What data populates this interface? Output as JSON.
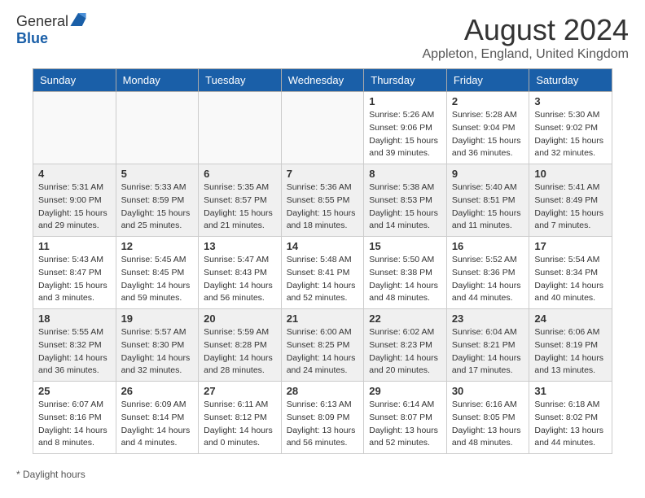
{
  "header": {
    "logo_general": "General",
    "logo_blue": "Blue",
    "month_title": "August 2024",
    "location": "Appleton, England, United Kingdom"
  },
  "legend": {
    "text": "* Daylight hours"
  },
  "days_of_week": [
    "Sunday",
    "Monday",
    "Tuesday",
    "Wednesday",
    "Thursday",
    "Friday",
    "Saturday"
  ],
  "weeks": [
    {
      "days": [
        {
          "num": "",
          "info": ""
        },
        {
          "num": "",
          "info": ""
        },
        {
          "num": "",
          "info": ""
        },
        {
          "num": "",
          "info": ""
        },
        {
          "num": "1",
          "info": "Sunrise: 5:26 AM\nSunset: 9:06 PM\nDaylight: 15 hours\nand 39 minutes."
        },
        {
          "num": "2",
          "info": "Sunrise: 5:28 AM\nSunset: 9:04 PM\nDaylight: 15 hours\nand 36 minutes."
        },
        {
          "num": "3",
          "info": "Sunrise: 5:30 AM\nSunset: 9:02 PM\nDaylight: 15 hours\nand 32 minutes."
        }
      ]
    },
    {
      "days": [
        {
          "num": "4",
          "info": "Sunrise: 5:31 AM\nSunset: 9:00 PM\nDaylight: 15 hours\nand 29 minutes."
        },
        {
          "num": "5",
          "info": "Sunrise: 5:33 AM\nSunset: 8:59 PM\nDaylight: 15 hours\nand 25 minutes."
        },
        {
          "num": "6",
          "info": "Sunrise: 5:35 AM\nSunset: 8:57 PM\nDaylight: 15 hours\nand 21 minutes."
        },
        {
          "num": "7",
          "info": "Sunrise: 5:36 AM\nSunset: 8:55 PM\nDaylight: 15 hours\nand 18 minutes."
        },
        {
          "num": "8",
          "info": "Sunrise: 5:38 AM\nSunset: 8:53 PM\nDaylight: 15 hours\nand 14 minutes."
        },
        {
          "num": "9",
          "info": "Sunrise: 5:40 AM\nSunset: 8:51 PM\nDaylight: 15 hours\nand 11 minutes."
        },
        {
          "num": "10",
          "info": "Sunrise: 5:41 AM\nSunset: 8:49 PM\nDaylight: 15 hours\nand 7 minutes."
        }
      ]
    },
    {
      "days": [
        {
          "num": "11",
          "info": "Sunrise: 5:43 AM\nSunset: 8:47 PM\nDaylight: 15 hours\nand 3 minutes."
        },
        {
          "num": "12",
          "info": "Sunrise: 5:45 AM\nSunset: 8:45 PM\nDaylight: 14 hours\nand 59 minutes."
        },
        {
          "num": "13",
          "info": "Sunrise: 5:47 AM\nSunset: 8:43 PM\nDaylight: 14 hours\nand 56 minutes."
        },
        {
          "num": "14",
          "info": "Sunrise: 5:48 AM\nSunset: 8:41 PM\nDaylight: 14 hours\nand 52 minutes."
        },
        {
          "num": "15",
          "info": "Sunrise: 5:50 AM\nSunset: 8:38 PM\nDaylight: 14 hours\nand 48 minutes."
        },
        {
          "num": "16",
          "info": "Sunrise: 5:52 AM\nSunset: 8:36 PM\nDaylight: 14 hours\nand 44 minutes."
        },
        {
          "num": "17",
          "info": "Sunrise: 5:54 AM\nSunset: 8:34 PM\nDaylight: 14 hours\nand 40 minutes."
        }
      ]
    },
    {
      "days": [
        {
          "num": "18",
          "info": "Sunrise: 5:55 AM\nSunset: 8:32 PM\nDaylight: 14 hours\nand 36 minutes."
        },
        {
          "num": "19",
          "info": "Sunrise: 5:57 AM\nSunset: 8:30 PM\nDaylight: 14 hours\nand 32 minutes."
        },
        {
          "num": "20",
          "info": "Sunrise: 5:59 AM\nSunset: 8:28 PM\nDaylight: 14 hours\nand 28 minutes."
        },
        {
          "num": "21",
          "info": "Sunrise: 6:00 AM\nSunset: 8:25 PM\nDaylight: 14 hours\nand 24 minutes."
        },
        {
          "num": "22",
          "info": "Sunrise: 6:02 AM\nSunset: 8:23 PM\nDaylight: 14 hours\nand 20 minutes."
        },
        {
          "num": "23",
          "info": "Sunrise: 6:04 AM\nSunset: 8:21 PM\nDaylight: 14 hours\nand 17 minutes."
        },
        {
          "num": "24",
          "info": "Sunrise: 6:06 AM\nSunset: 8:19 PM\nDaylight: 14 hours\nand 13 minutes."
        }
      ]
    },
    {
      "days": [
        {
          "num": "25",
          "info": "Sunrise: 6:07 AM\nSunset: 8:16 PM\nDaylight: 14 hours\nand 8 minutes."
        },
        {
          "num": "26",
          "info": "Sunrise: 6:09 AM\nSunset: 8:14 PM\nDaylight: 14 hours\nand 4 minutes."
        },
        {
          "num": "27",
          "info": "Sunrise: 6:11 AM\nSunset: 8:12 PM\nDaylight: 14 hours\nand 0 minutes."
        },
        {
          "num": "28",
          "info": "Sunrise: 6:13 AM\nSunset: 8:09 PM\nDaylight: 13 hours\nand 56 minutes."
        },
        {
          "num": "29",
          "info": "Sunrise: 6:14 AM\nSunset: 8:07 PM\nDaylight: 13 hours\nand 52 minutes."
        },
        {
          "num": "30",
          "info": "Sunrise: 6:16 AM\nSunset: 8:05 PM\nDaylight: 13 hours\nand 48 minutes."
        },
        {
          "num": "31",
          "info": "Sunrise: 6:18 AM\nSunset: 8:02 PM\nDaylight: 13 hours\nand 44 minutes."
        }
      ]
    }
  ]
}
